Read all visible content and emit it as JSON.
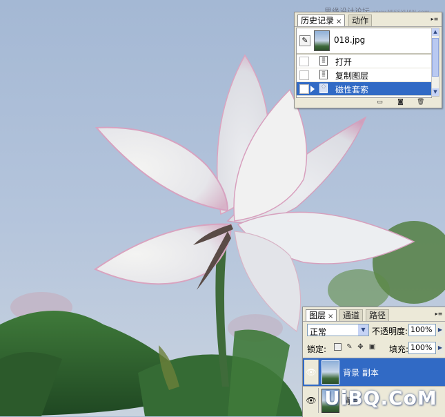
{
  "watermark": {
    "top_text": "思缘设计论坛",
    "top_url": "www.MISSYUAN.com",
    "bottom_text": "UiBQ.CoM"
  },
  "history_panel": {
    "tabs": [
      {
        "label": "历史记录",
        "active": true
      },
      {
        "label": "动作",
        "active": false
      }
    ],
    "close_glyph": "×",
    "snapshot": {
      "name": "018.jpg",
      "brush_icon": "history-brush-icon"
    },
    "steps": [
      {
        "label": "打开",
        "selected": false,
        "icon": "history-state-icon"
      },
      {
        "label": "复制图层",
        "selected": false,
        "icon": "history-state-icon"
      },
      {
        "label": "磁性套索",
        "selected": true,
        "icon": "magnetic-lasso-icon"
      }
    ],
    "footer_icons": [
      "new-document-from-state-icon",
      "new-snapshot-icon",
      "delete-state-icon"
    ]
  },
  "layers_panel": {
    "tabs": [
      {
        "label": "图层",
        "active": true
      },
      {
        "label": "通道",
        "active": false
      },
      {
        "label": "路径",
        "active": false
      }
    ],
    "close_glyph": "×",
    "blend_mode": "正常",
    "opacity_label": "不透明度:",
    "opacity_value": "100%",
    "lock_label": "锁定:",
    "fill_label": "填充:",
    "fill_value": "100%",
    "layers": [
      {
        "name": "背景 副本",
        "selected": true,
        "visible": true
      },
      {
        "name": "背景",
        "selected": false,
        "visible": true
      }
    ]
  },
  "colors": {
    "selection": "#316ac5",
    "panel_bg": "#ece9d8",
    "sky": "#a9bcd6"
  }
}
